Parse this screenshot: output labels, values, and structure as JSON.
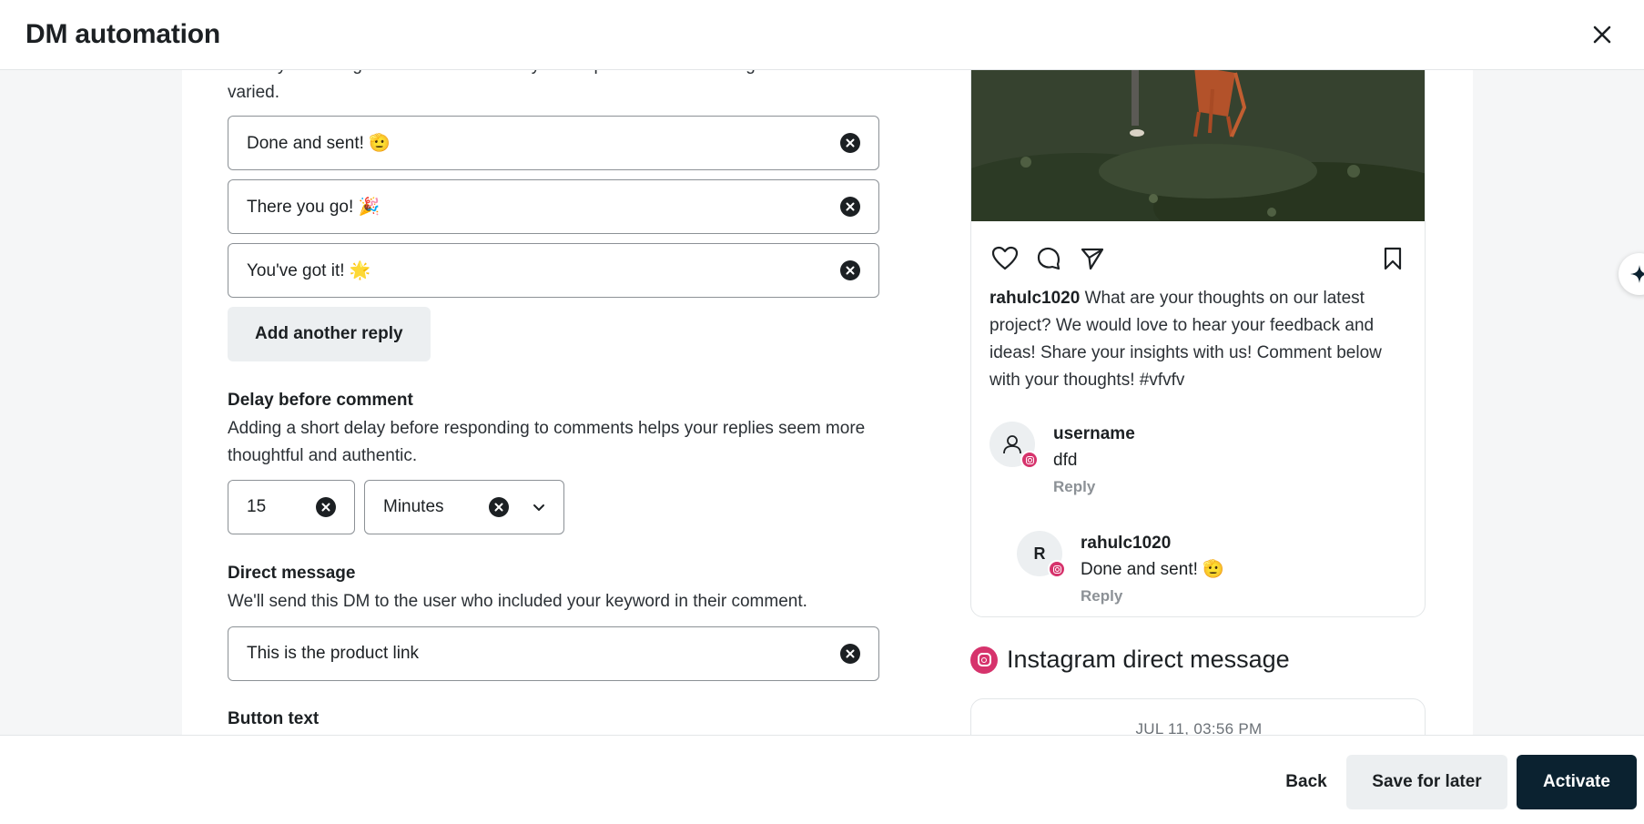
{
  "header": {
    "title": "DM automation"
  },
  "replies": {
    "intro": "We'll cycle through these comments so your responses seem more genuine and varied.",
    "items": [
      "Done and sent! 🫡",
      "There you go! 🎉",
      "You've got it! 🌟"
    ],
    "add_label": "Add another reply"
  },
  "delay": {
    "label": "Delay before comment",
    "description": "Adding a short delay before responding to comments helps your replies seem more thoughtful and authentic.",
    "amount": "15",
    "unit": "Minutes"
  },
  "direct_message": {
    "label": "Direct message",
    "description": "We'll send this DM to the user who included your keyword in their comment.",
    "value": "This is the product link"
  },
  "button_text": {
    "label": "Button text"
  },
  "preview": {
    "caption_user": "rahulc1020",
    "caption_text": "What are your thoughts on our latest project? We would love to hear your feedback and ideas! Share your insights with us! Comment below with your thoughts! #vfvfv",
    "comment": {
      "user": "username",
      "text": "dfd",
      "reply": "Reply"
    },
    "response": {
      "avatar_initial": "R",
      "user": "rahulc1020",
      "text": "Done and sent! 🫡",
      "reply": "Reply"
    },
    "dm_heading": "Instagram direct message",
    "dm_time": "JUL 11, 03:56 PM"
  },
  "footer": {
    "back": "Back",
    "save": "Save for later",
    "activate": "Activate"
  },
  "colors": {
    "primary": "#0b2230",
    "instagram": "#d6336c",
    "muted": "#8c9196"
  }
}
